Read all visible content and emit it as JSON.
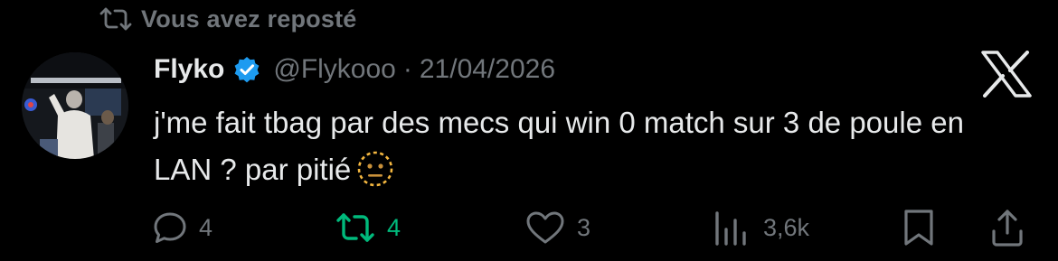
{
  "repost": {
    "label": "Vous avez reposté"
  },
  "author": {
    "name": "Flyko",
    "handle": "@Flykooo",
    "separator": "·",
    "date": "21/04/2026",
    "verified": true
  },
  "tweet": {
    "text": "j'me fait tbag par des mecs qui win 0 match sur 3 de poule en LAN ? par pitié",
    "emoji": "neutral-face-dotted-icon"
  },
  "actions": {
    "replies": "4",
    "reposts": "4",
    "likes": "3",
    "views": "3,6k"
  },
  "colors": {
    "background": "#000000",
    "text": "#e7e9ea",
    "muted": "#71767b",
    "repost_green": "#00ba7c",
    "verified_blue": "#1d9bf0"
  },
  "icons": [
    "repost-icon",
    "verified-badge-icon",
    "x-logo-icon",
    "reply-icon",
    "repost-icon",
    "like-icon",
    "views-icon",
    "bookmark-icon",
    "share-icon"
  ]
}
